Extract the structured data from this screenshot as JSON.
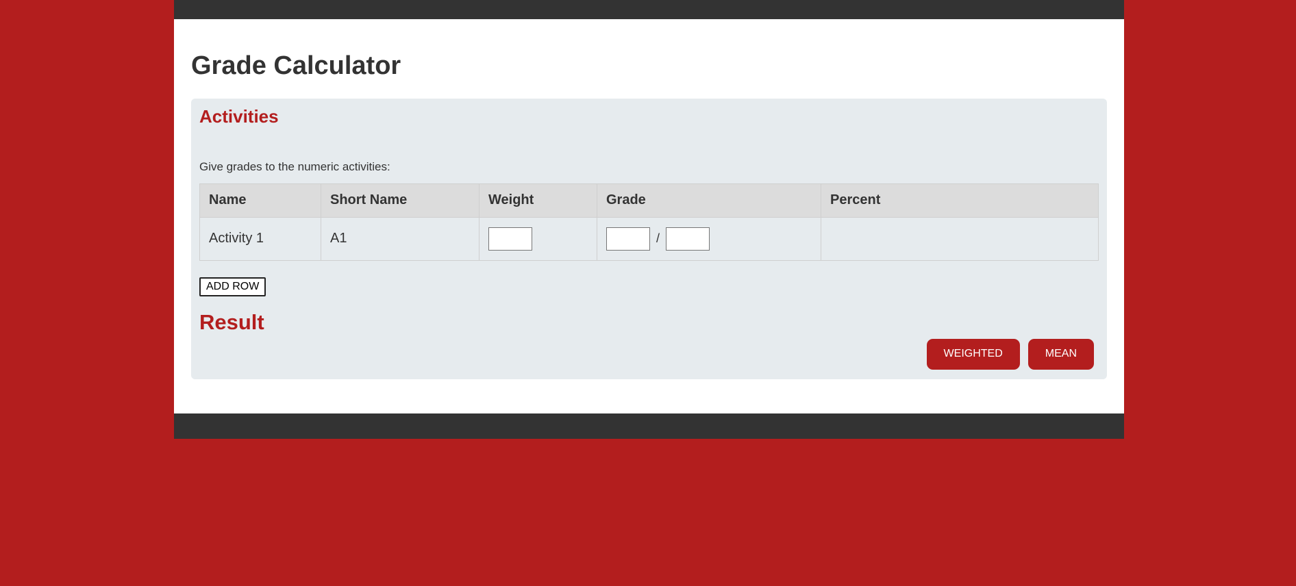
{
  "page": {
    "title": "Grade Calculator"
  },
  "activities": {
    "heading": "Activities",
    "instructions": "Give grades to the numeric activities:",
    "columns": [
      "Name",
      "Short Name",
      "Weight",
      "Grade",
      "Percent"
    ],
    "rows": [
      {
        "name": "Activity 1",
        "short_name": "A1",
        "weight": "",
        "grade_earned": "",
        "grade_separator": "/",
        "grade_possible": "",
        "percent": ""
      }
    ],
    "add_row_label": "ADD ROW"
  },
  "result": {
    "heading": "Result",
    "weighted_label": "WEIGHTED",
    "mean_label": "MEAN"
  },
  "colors": {
    "accent": "#b31e1e",
    "bars": "#333333",
    "panel": "#e6ebee",
    "table_header": "#dcdcdc"
  }
}
